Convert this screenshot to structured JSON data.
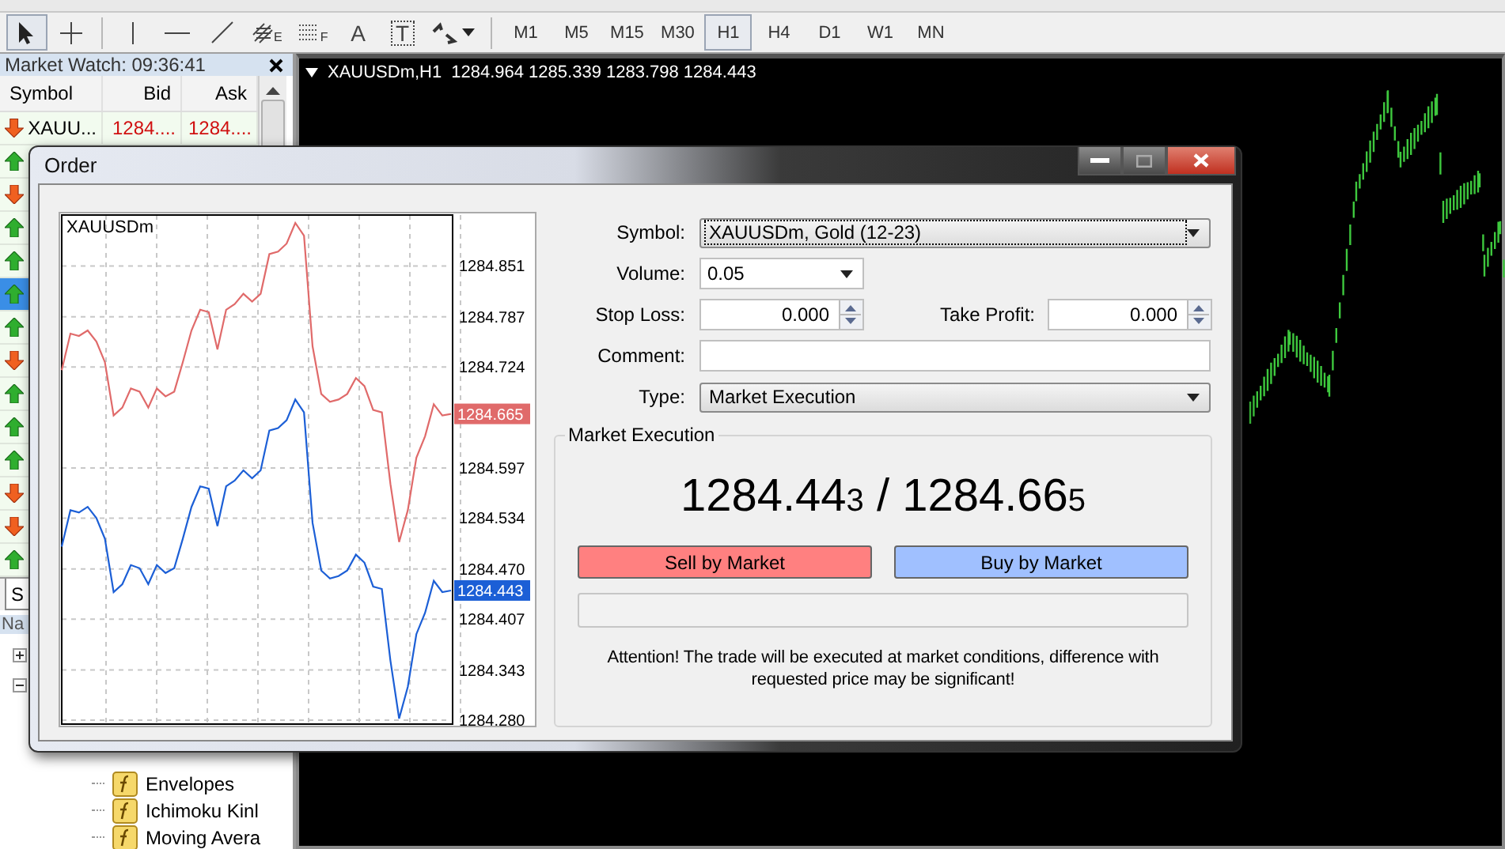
{
  "toolbar": {
    "tools": [
      {
        "kind": "cursor",
        "selected": true
      },
      {
        "kind": "crosshair",
        "selected": false
      },
      {
        "kind": "vertical_line",
        "selected": false
      },
      {
        "kind": "horizontal_line",
        "selected": false
      },
      {
        "kind": "trendline",
        "selected": false
      },
      {
        "kind": "fibo_fan",
        "badge": "E",
        "selected": false
      },
      {
        "kind": "fibo_levels",
        "badge": "F",
        "selected": false
      },
      {
        "kind": "text",
        "glyph": "A",
        "selected": false
      },
      {
        "kind": "text_label",
        "glyph": "T",
        "selected": false
      },
      {
        "kind": "arrows",
        "selected": false
      }
    ],
    "timeframes": [
      {
        "label": "M1",
        "selected": false
      },
      {
        "label": "M5",
        "selected": false
      },
      {
        "label": "M15",
        "selected": false
      },
      {
        "label": "M30",
        "selected": false
      },
      {
        "label": "H1",
        "selected": true
      },
      {
        "label": "H4",
        "selected": false
      },
      {
        "label": "D1",
        "selected": false
      },
      {
        "label": "W1",
        "selected": false
      },
      {
        "label": "MN",
        "selected": false
      }
    ]
  },
  "market_watch": {
    "title": "Market Watch: 09:36:41",
    "columns": [
      "Symbol",
      "Bid",
      "Ask"
    ],
    "rows": [
      {
        "symbol": "XAUU...",
        "bid": "1284....",
        "ask": "1284....",
        "rising": false,
        "selected": false
      },
      {
        "rising": true,
        "selected": false
      },
      {
        "rising": false,
        "selected": false
      },
      {
        "rising": true,
        "selected": false
      },
      {
        "rising": true,
        "selected": false
      },
      {
        "rising": true,
        "selected": true
      },
      {
        "rising": true,
        "selected": false
      },
      {
        "rising": false,
        "selected": false
      },
      {
        "rising": true,
        "selected": false
      },
      {
        "rising": true,
        "selected": false
      },
      {
        "rising": true,
        "selected": false
      },
      {
        "rising": false,
        "selected": false
      },
      {
        "rising": false,
        "selected": false
      },
      {
        "rising": true,
        "selected": false
      }
    ],
    "tabs": [
      {
        "label": "S",
        "selected": true
      }
    ]
  },
  "navigator": {
    "title": "Na",
    "tree": [
      {
        "expanded": false
      },
      {
        "expanded": true,
        "children": [
          {
            "label": "Envelopes"
          },
          {
            "label": "Ichimoku Kinl"
          },
          {
            "label": "Moving Avera"
          }
        ]
      }
    ]
  },
  "chart_window": {
    "symbol": "XAUUSDm,H1",
    "ohlc": "1284.964 1285.339 1283.798 1284.443"
  },
  "order_dialog": {
    "title": "Order",
    "chart": {
      "label": "XAUUSDm",
      "chart_data": {
        "type": "line",
        "categories": [
          null,
          null,
          null,
          null,
          null,
          null,
          null,
          null,
          null,
          null,
          null,
          null,
          null,
          null,
          null,
          null,
          null,
          null,
          null,
          null,
          null,
          null,
          null,
          null,
          null,
          null,
          null,
          null,
          null,
          null,
          null,
          null,
          null,
          null,
          null,
          null,
          null,
          null,
          null,
          null,
          null,
          null,
          null,
          null,
          null,
          null
        ],
        "ylim": [
          1284.275,
          1284.915
        ],
        "grid": true,
        "series": [
          {
            "color": "#e06a6a",
            "values": [
              1284.72,
              1284.766,
              1284.763,
              1284.77,
              1284.756,
              1284.73,
              1284.663,
              1284.673,
              1284.697,
              1284.693,
              1284.673,
              1284.697,
              1284.687,
              1284.693,
              1284.73,
              1284.77,
              1284.796,
              1284.793,
              1284.746,
              1284.796,
              1284.803,
              1284.816,
              1284.806,
              1284.816,
              1284.866,
              1284.869,
              1284.879,
              1284.905,
              1284.889,
              1284.75,
              1284.69,
              1284.68,
              1284.683,
              1284.69,
              1284.71,
              1284.7,
              1284.67,
              1284.667,
              1284.577,
              1284.504,
              1284.544,
              1284.61,
              1284.637,
              1284.677,
              1284.663,
              1284.665
            ]
          },
          {
            "color": "#1c5fd6",
            "values": [
              1284.498,
              1284.544,
              1284.541,
              1284.548,
              1284.534,
              1284.508,
              1284.441,
              1284.451,
              1284.475,
              1284.471,
              1284.451,
              1284.475,
              1284.465,
              1284.471,
              1284.508,
              1284.548,
              1284.574,
              1284.571,
              1284.524,
              1284.574,
              1284.581,
              1284.594,
              1284.584,
              1284.594,
              1284.644,
              1284.647,
              1284.657,
              1284.683,
              1284.667,
              1284.528,
              1284.468,
              1284.458,
              1284.461,
              1284.468,
              1284.488,
              1284.478,
              1284.448,
              1284.445,
              1284.355,
              1284.282,
              1284.322,
              1284.388,
              1284.415,
              1284.455,
              1284.441,
              1284.443
            ]
          }
        ],
        "yticks": [
          {
            "value": 1284.851,
            "label": "1284.851"
          },
          {
            "value": 1284.787,
            "label": "1284.787"
          },
          {
            "value": 1284.724,
            "label": "1284.724"
          },
          {
            "value": 1284.597,
            "label": "1284.597"
          },
          {
            "value": 1284.534,
            "label": "1284.534"
          },
          {
            "value": 1284.47,
            "label": "1284.470"
          },
          {
            "value": 1284.407,
            "label": "1284.407"
          },
          {
            "value": 1284.343,
            "label": "1284.343"
          },
          {
            "value": 1284.28,
            "label": "1284.280"
          }
        ]
      },
      "price_tags": [
        {
          "kind": "ask",
          "label": "1284.665"
        },
        {
          "kind": "bid",
          "label": "1284.443"
        }
      ]
    },
    "form": {
      "symbol": {
        "label": "Symbol:",
        "value": "XAUUSDm, Gold (12-23)",
        "focused": true
      },
      "volume": {
        "label": "Volume:",
        "value": "0.05"
      },
      "stop_loss": {
        "label": "Stop Loss:",
        "value": "0.000"
      },
      "take_profit": {
        "label": "Take Profit:",
        "value": "0.000"
      },
      "comment": {
        "label": "Comment:"
      },
      "type": {
        "label": "Type:",
        "value": "Market Execution"
      }
    },
    "execution": {
      "title": "Market Execution",
      "bid": {
        "main": "1284.44",
        "small": "3"
      },
      "separator": "/",
      "ask": {
        "main": "1284.66",
        "small": "5"
      },
      "buttons": [
        {
          "kind": "sell",
          "label": "Sell by Market"
        },
        {
          "kind": "buy",
          "label": "Buy by Market"
        }
      ],
      "notice": "Attention! The trade will be executed at market conditions, difference with requested price may be significant!"
    }
  }
}
